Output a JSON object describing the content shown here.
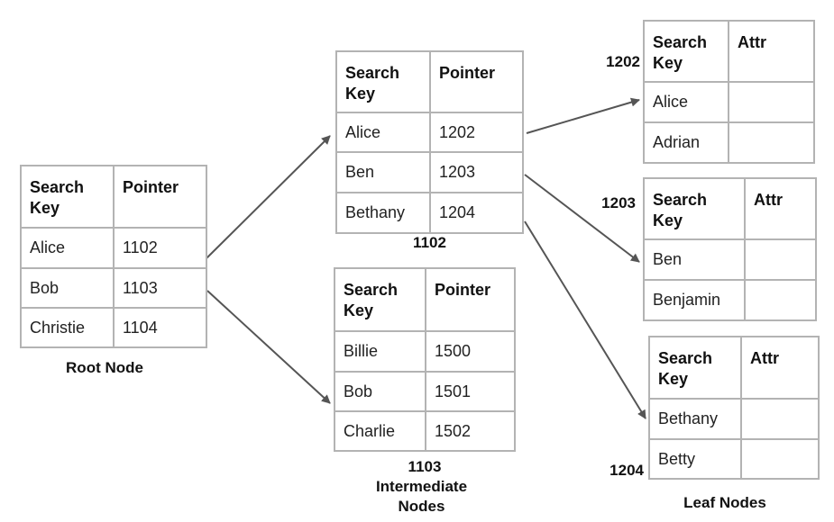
{
  "root": {
    "label": "Root Node",
    "headers": [
      "Search Key",
      "Pointer"
    ],
    "rows": [
      [
        "Alice",
        "1102"
      ],
      [
        "Bob",
        "1103"
      ],
      [
        "Christie",
        "1104"
      ]
    ]
  },
  "intermediate": {
    "caption": "Intermediate Nodes",
    "nodes": [
      {
        "id": "1102",
        "headers": [
          "Search Key",
          "Pointer"
        ],
        "rows": [
          [
            "Alice",
            "1202"
          ],
          [
            "Ben",
            "1203"
          ],
          [
            "Bethany",
            "1204"
          ]
        ]
      },
      {
        "id": "1103",
        "headers": [
          "Search Key",
          "Pointer"
        ],
        "rows": [
          [
            "Billie",
            "1500"
          ],
          [
            "Bob",
            "1501"
          ],
          [
            "Charlie",
            "1502"
          ]
        ]
      }
    ]
  },
  "leaves": {
    "caption": "Leaf Nodes",
    "nodes": [
      {
        "id": "1202",
        "headers": [
          "Search Key",
          "Attr"
        ],
        "rows": [
          [
            "Alice",
            ""
          ],
          [
            "Adrian",
            ""
          ]
        ]
      },
      {
        "id": "1203",
        "headers": [
          "Search Key",
          "Attr"
        ],
        "rows": [
          [
            "Ben",
            ""
          ],
          [
            "Benjamin",
            ""
          ]
        ]
      },
      {
        "id": "1204",
        "headers": [
          "Search Key",
          "Attr"
        ],
        "rows": [
          [
            "Bethany",
            ""
          ],
          [
            "Betty",
            ""
          ]
        ]
      }
    ]
  },
  "edges": [
    {
      "from": "root:Alice",
      "to": "1102"
    },
    {
      "from": "root:Bob",
      "to": "1103"
    },
    {
      "from": "1102:Alice",
      "to": "1202"
    },
    {
      "from": "1102:Ben",
      "to": "1203"
    },
    {
      "from": "1102:Bethany",
      "to": "1204"
    }
  ],
  "colors": {
    "border": "#b3b3b3",
    "arrow": "#555555",
    "text": "#222222"
  }
}
